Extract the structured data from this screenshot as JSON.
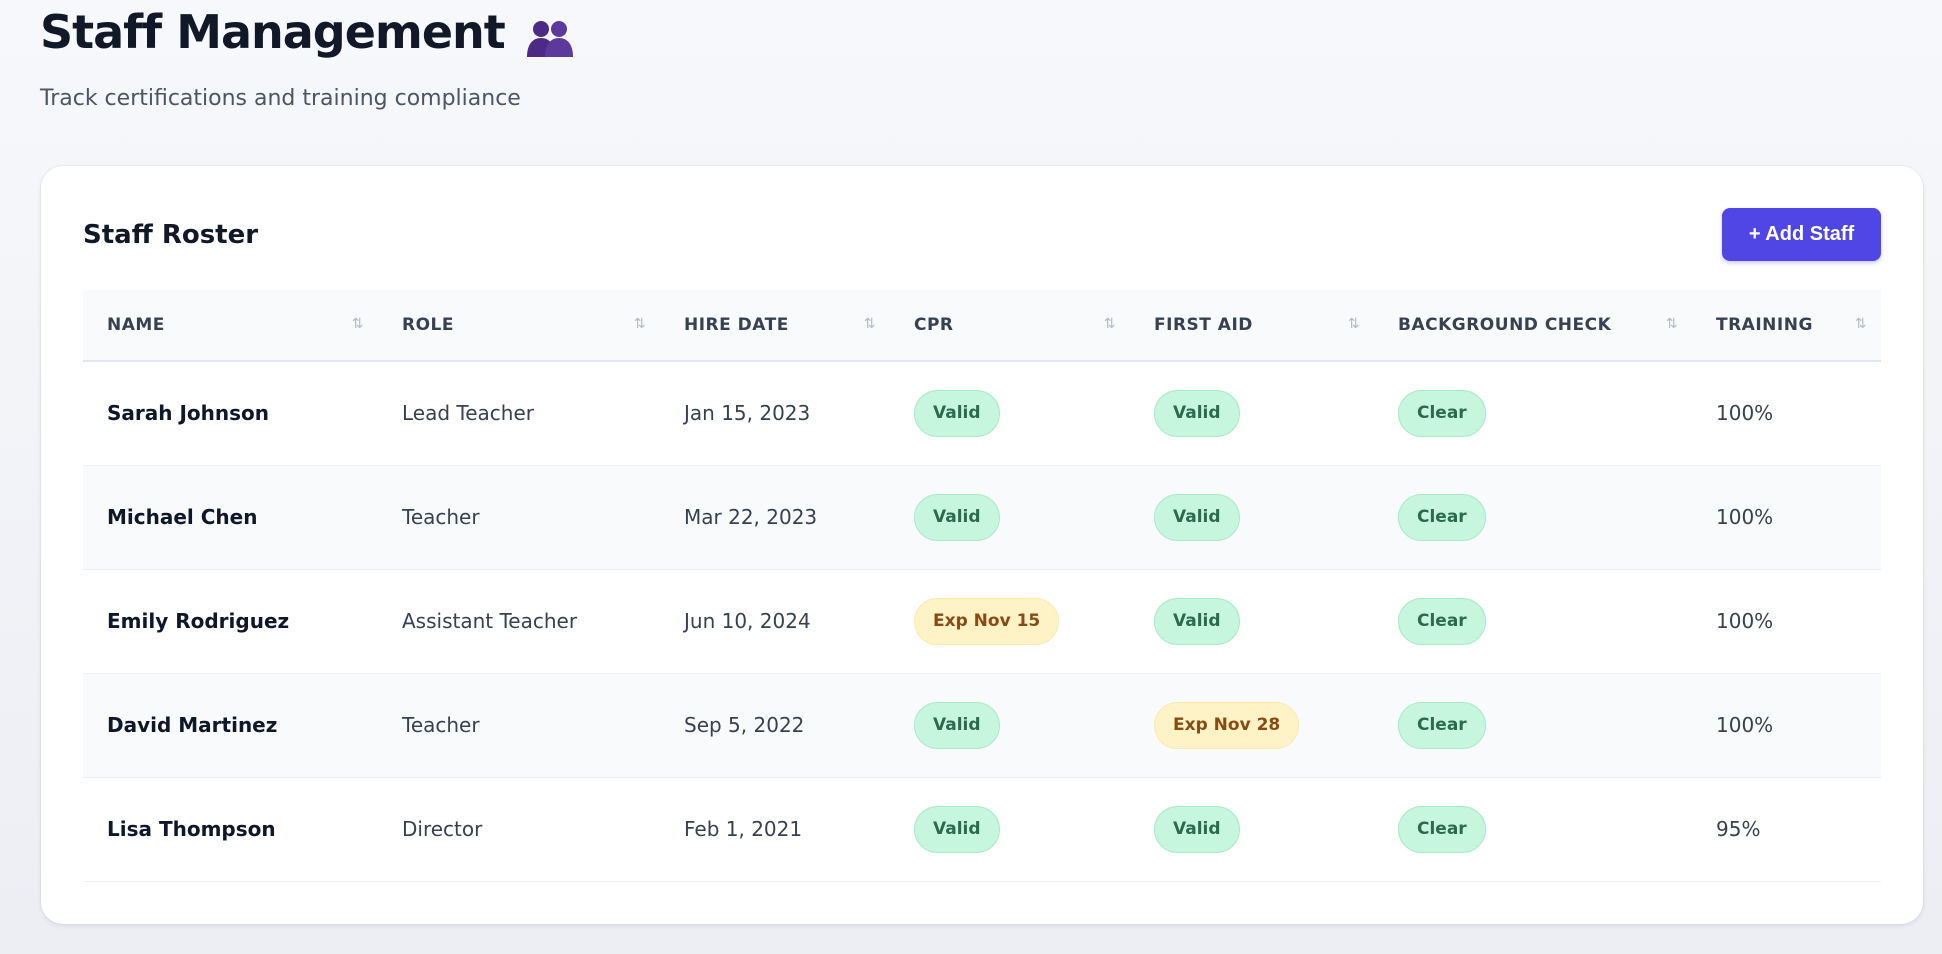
{
  "header": {
    "title": "Staff Management",
    "subtitle": "Track certifications and training compliance",
    "icon": "people-icon"
  },
  "card": {
    "title": "Staff Roster",
    "add_button_label": "+ Add Staff"
  },
  "colors": {
    "accent": "#4f46e5",
    "valid_bg": "#c6f6dd",
    "valid_text": "#2b6b4b",
    "warn_bg": "#fef3c7",
    "warn_text": "#8a4b12"
  },
  "table": {
    "columns": [
      "NAME",
      "ROLE",
      "HIRE DATE",
      "CPR",
      "FIRST AID",
      "BACKGROUND CHECK",
      "TRAINING"
    ],
    "sort_icon": "sort-icon",
    "rows": [
      {
        "name": "Sarah Johnson",
        "role": "Lead Teacher",
        "hire_date": "Jan 15, 2023",
        "cpr": "Valid",
        "cpr_status": "ok",
        "first_aid": "Valid",
        "first_aid_status": "ok",
        "background": "Clear",
        "training": "100%"
      },
      {
        "name": "Michael Chen",
        "role": "Teacher",
        "hire_date": "Mar 22, 2023",
        "cpr": "Valid",
        "cpr_status": "ok",
        "first_aid": "Valid",
        "first_aid_status": "ok",
        "background": "Clear",
        "training": "100%"
      },
      {
        "name": "Emily Rodriguez",
        "role": "Assistant Teacher",
        "hire_date": "Jun 10, 2024",
        "cpr": "Exp Nov 15",
        "cpr_status": "warn",
        "first_aid": "Valid",
        "first_aid_status": "ok",
        "background": "Clear",
        "training": "100%"
      },
      {
        "name": "David Martinez",
        "role": "Teacher",
        "hire_date": "Sep 5, 2022",
        "cpr": "Valid",
        "cpr_status": "ok",
        "first_aid": "Exp Nov 28",
        "first_aid_status": "warn",
        "background": "Clear",
        "training": "100%"
      },
      {
        "name": "Lisa Thompson",
        "role": "Director",
        "hire_date": "Feb 1, 2021",
        "cpr": "Valid",
        "cpr_status": "ok",
        "first_aid": "Valid",
        "first_aid_status": "ok",
        "background": "Clear",
        "training": "95%"
      }
    ]
  }
}
